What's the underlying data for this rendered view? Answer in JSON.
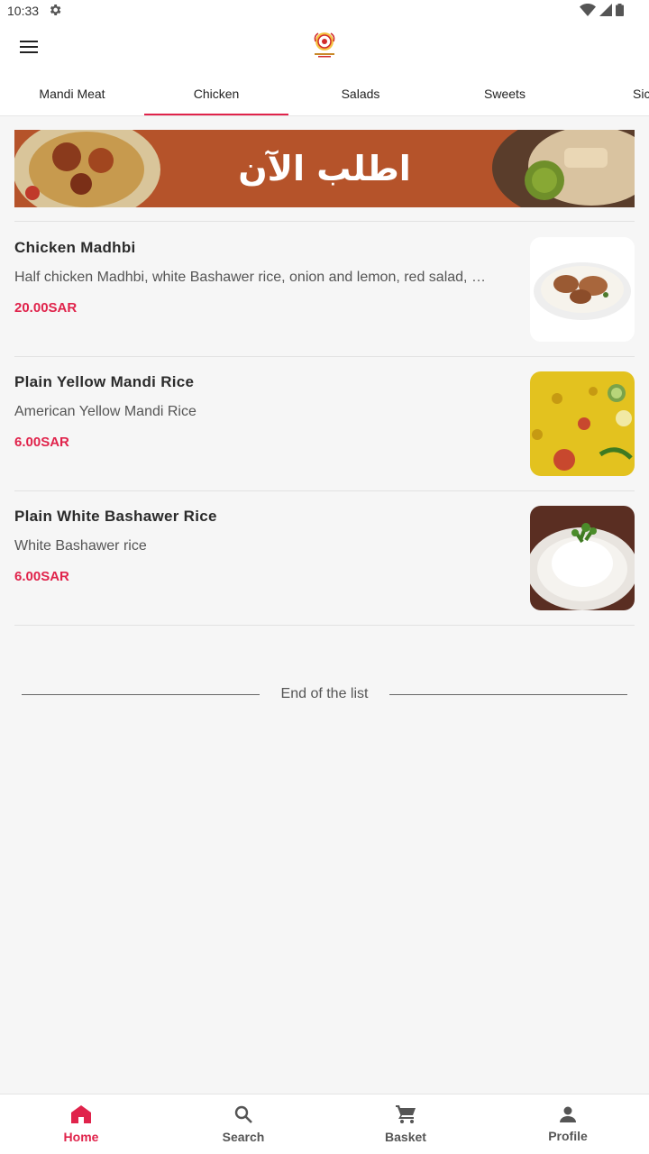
{
  "status_bar": {
    "time": "10:33",
    "icons": [
      "gear-icon",
      "wifi-icon",
      "signal-icon",
      "battery-icon"
    ]
  },
  "header": {
    "menu_icon": "hamburger-menu-icon",
    "logo": "restaurant-logo"
  },
  "tabs": [
    {
      "label": "Mandi Meat",
      "active": false
    },
    {
      "label": "Chicken",
      "active": true
    },
    {
      "label": "Salads",
      "active": false
    },
    {
      "label": "Sweets",
      "active": false
    },
    {
      "label": "Sic",
      "active": false
    }
  ],
  "banner": {
    "text": "اطلب الآن"
  },
  "items": [
    {
      "name": "Chicken Madhbi",
      "description": "Half chicken Madhbi, white Bashawer rice, onion and lemon, red salad, …",
      "price": "20.00SAR"
    },
    {
      "name": "Plain Yellow Mandi Rice",
      "description": "American Yellow Mandi Rice",
      "price": "6.00SAR"
    },
    {
      "name": "Plain White Bashawer Rice",
      "description": "White Bashawer rice",
      "price": "6.00SAR"
    }
  ],
  "end_of_list": "End of the list",
  "bottom_nav": [
    {
      "label": "Home",
      "icon": "home-icon",
      "active": true
    },
    {
      "label": "Search",
      "icon": "search-icon",
      "active": false
    },
    {
      "label": "Basket",
      "icon": "cart-icon",
      "active": false
    },
    {
      "label": "Profile",
      "icon": "person-icon",
      "active": false
    }
  ],
  "colors": {
    "accent": "#e0234b",
    "banner_bg": "#b5532a",
    "background": "#f6f6f6"
  }
}
